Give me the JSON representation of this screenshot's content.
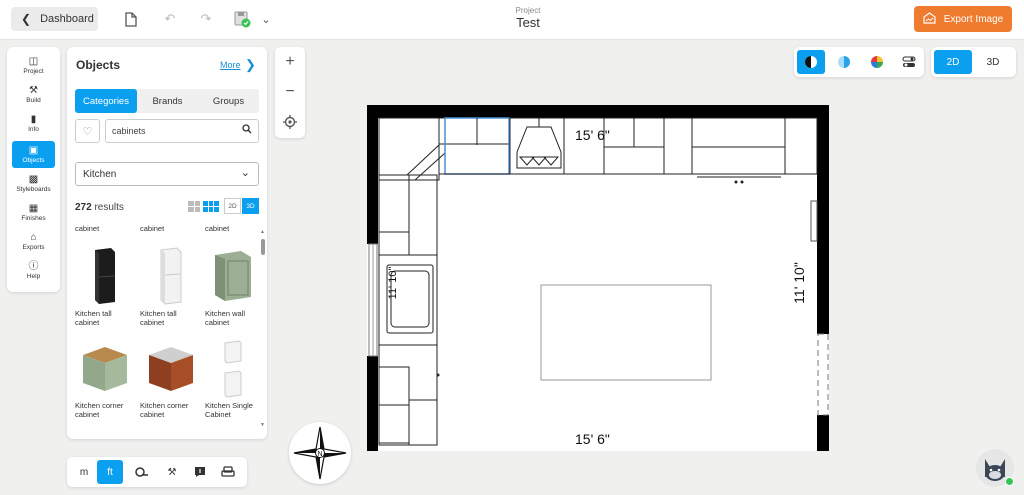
{
  "header": {
    "dashboard_label": "Dashboard",
    "project_label": "Project",
    "project_name": "Test",
    "export_label": "Export Image"
  },
  "left_rail": {
    "items": [
      {
        "label": "Project",
        "icon": "layout-icon"
      },
      {
        "label": "Build",
        "icon": "tools-icon"
      },
      {
        "label": "Info",
        "icon": "info-icon"
      },
      {
        "label": "Objects",
        "icon": "sofa-icon"
      },
      {
        "label": "Styleboards",
        "icon": "styleboard-icon"
      },
      {
        "label": "Finishes",
        "icon": "paint-roller-icon"
      },
      {
        "label": "Exports",
        "icon": "export-icon"
      },
      {
        "label": "Help",
        "icon": "help-icon"
      }
    ],
    "active": "Objects"
  },
  "objects_panel": {
    "title": "Objects",
    "more_label": "More",
    "tabs": [
      "Categories",
      "Brands",
      "Groups"
    ],
    "active_tab": "Categories",
    "search_value": "cabinets",
    "category": "Kitchen",
    "results_count": "272",
    "results_label": "results",
    "view_2d": "2D",
    "view_3d": "3D",
    "top_labels": [
      "cabinet",
      "cabinet",
      "cabinet"
    ],
    "items": [
      {
        "label": "Kitchen tall cabinet",
        "thumb": "tall-black-cabinet"
      },
      {
        "label": "Kitchen tall cabinet",
        "thumb": "tall-white-cabinet"
      },
      {
        "label": "Kitchen wall cabinet",
        "thumb": "green-wall-cabinet"
      },
      {
        "label": "Kitchen corner cabinet",
        "thumb": "green-corner-cabinet"
      },
      {
        "label": "Kitchen corner cabinet",
        "thumb": "wood-corner-cabinet"
      },
      {
        "label": "Kitchen Single Cabinet",
        "thumb": "white-single-cabinet"
      }
    ]
  },
  "units": {
    "metric": "m",
    "imperial": "ft",
    "active": "ft"
  },
  "view_controls": {
    "mode_2d": "2D",
    "mode_3d": "3D",
    "active_mode": "2D",
    "accent": "#0b9ff0"
  },
  "floorplan": {
    "dim_top": "15' 6\"",
    "dim_bottom": "15' 6\"",
    "dim_right": "11' 10\"",
    "dim_left": "11' 10\""
  },
  "colors": {
    "accent": "#0b9ff0",
    "export": "#ef7b2f",
    "status_online": "#37c456"
  }
}
